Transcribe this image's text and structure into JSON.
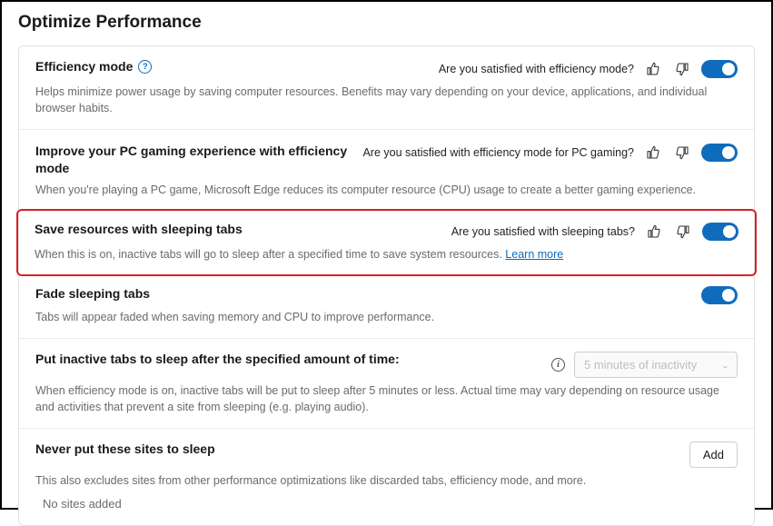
{
  "page": {
    "title": "Optimize Performance"
  },
  "efficiency": {
    "title": "Efficiency mode",
    "ask": "Are you satisfied with efficiency mode?",
    "desc": "Helps minimize power usage by saving computer resources. Benefits may vary depending on your device, applications, and individual browser habits."
  },
  "gaming": {
    "title": "Improve your PC gaming experience with efficiency mode",
    "ask": "Are you satisfied with efficiency mode for PC gaming?",
    "desc": "When you're playing a PC game, Microsoft Edge reduces its computer resource (CPU) usage to create a better gaming experience."
  },
  "sleeping": {
    "title": "Save resources with sleeping tabs",
    "ask": "Are you satisfied with sleeping tabs?",
    "desc_pre": "When this is on, inactive tabs will go to sleep after a specified time to save system resources. ",
    "learn_more": "Learn more"
  },
  "fade": {
    "title": "Fade sleeping tabs",
    "desc": "Tabs will appear faded when saving memory and CPU to improve performance."
  },
  "timeout": {
    "title": "Put inactive tabs to sleep after the specified amount of time:",
    "selected": "5 minutes of inactivity",
    "desc": "When efficiency mode is on, inactive tabs will be put to sleep after 5 minutes or less. Actual time may vary depending on resource usage and activities that prevent a site from sleeping (e.g. playing audio)."
  },
  "exclusions": {
    "title": "Never put these sites to sleep",
    "add": "Add",
    "desc": "This also excludes sites from other performance optimizations like discarded tabs, efficiency mode, and more.",
    "empty": "No sites added"
  }
}
